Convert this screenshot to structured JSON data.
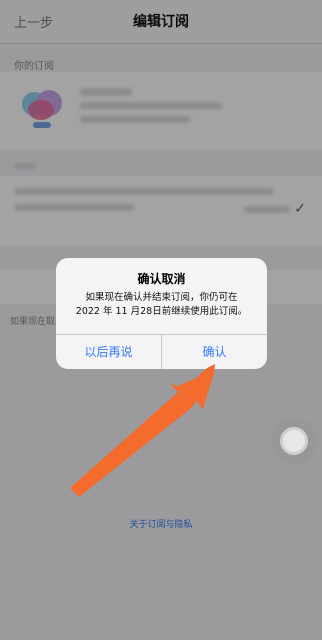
{
  "nav": {
    "back_label": "上一步",
    "title": "编辑订阅"
  },
  "section": {
    "your_subscriptions": "你的订阅"
  },
  "subscription": {
    "app_icon": "app-icon"
  },
  "options": {
    "check_icon": "checkmark-icon",
    "check_glyph": "✓"
  },
  "footer": {
    "cancel_note_prefix": "如果现在取",
    "about_link": "关于订阅与隐私"
  },
  "alert": {
    "title": "确认取消",
    "message_line1": "如果现在确认并结束订阅，你仍可在",
    "message_line2": "2022 年 11 月28日前继续使用此订阅。",
    "later_label": "以后再说",
    "confirm_label": "确认"
  },
  "annotation": {
    "arrow_icon": "arrow-icon",
    "arrow_color": "#f36b2d"
  },
  "colors": {
    "link": "#3478f6",
    "overlay": "rgba(0,0,0,0.36)"
  }
}
